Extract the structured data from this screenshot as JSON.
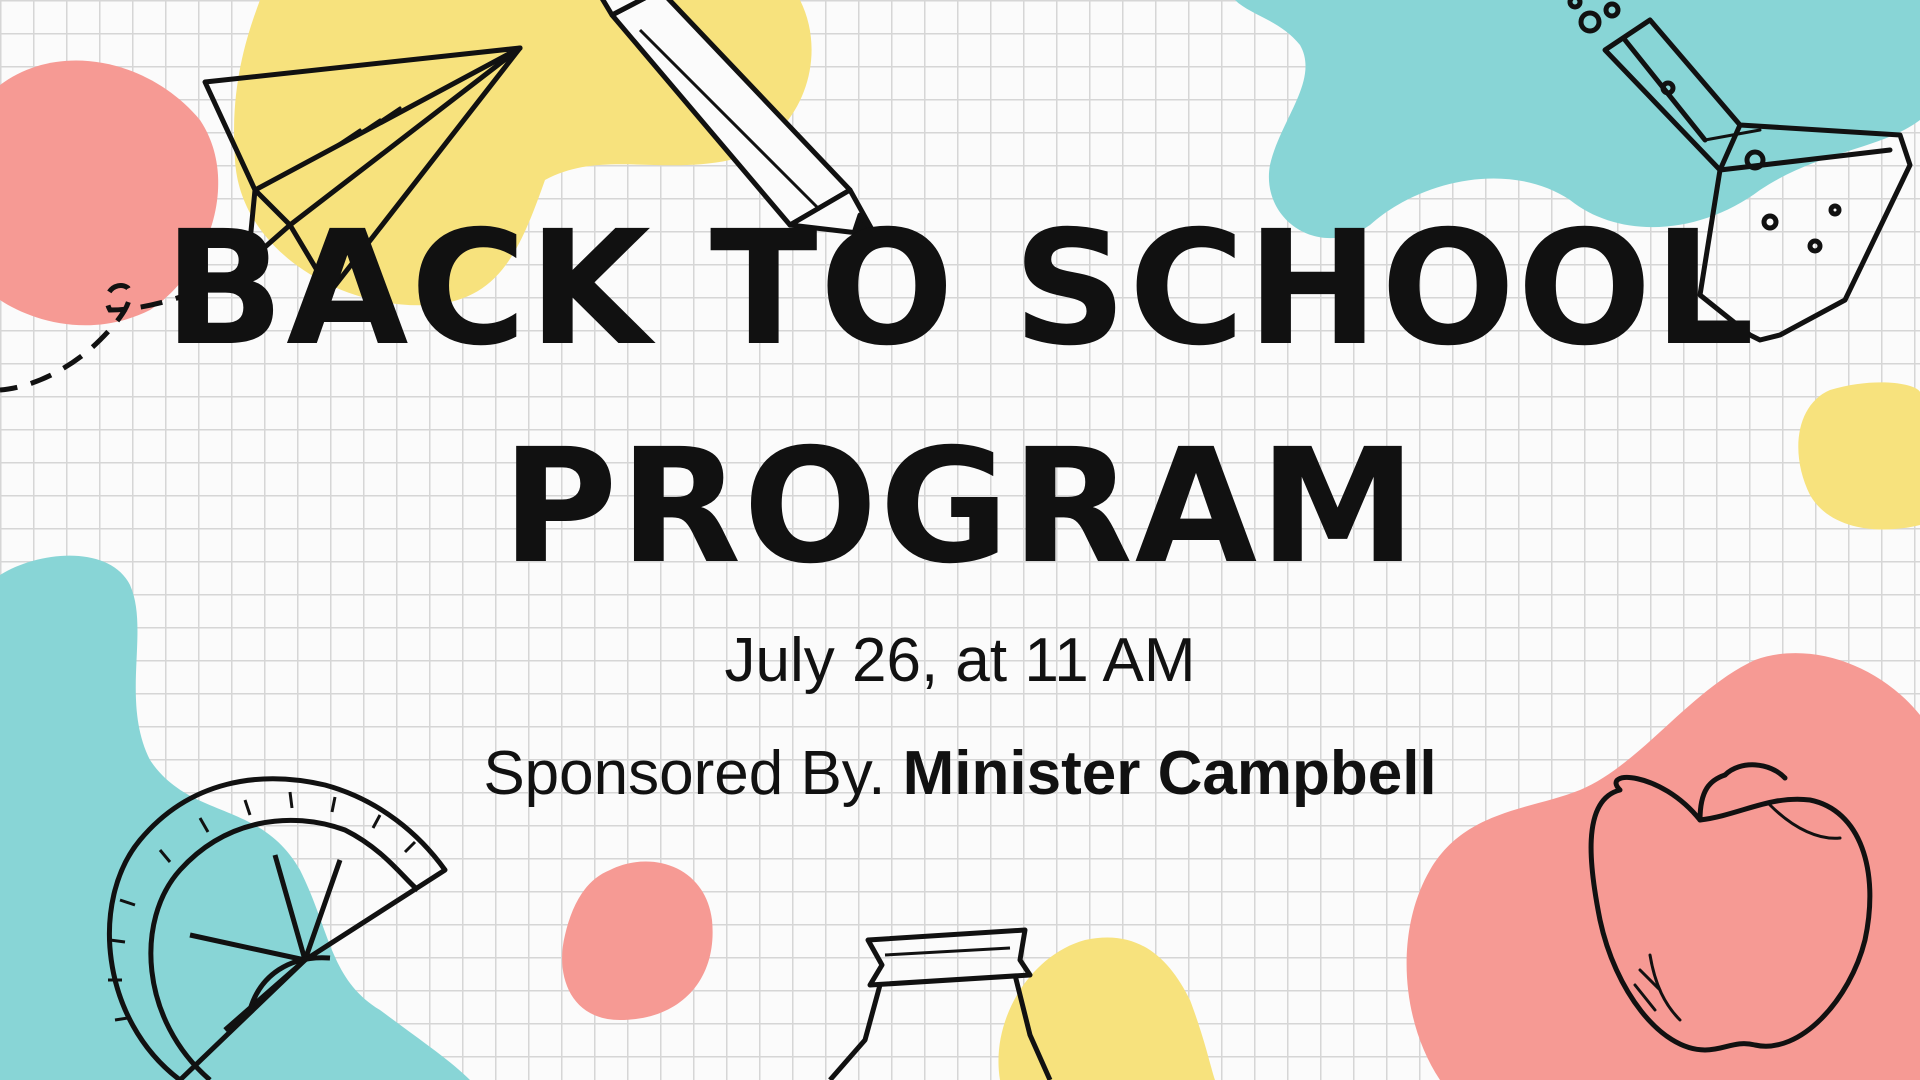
{
  "title": {
    "line1": "BACK TO SCHOOL",
    "line2": "PROGRAM"
  },
  "event_date": "July 26, at 11 AM",
  "sponsor": {
    "prefix": "Sponsored By. ",
    "name": "Minister Campbell"
  },
  "colors": {
    "pink": "#f69a94",
    "yellow": "#f7e27d",
    "teal": "#88d5d6",
    "ink": "#111111"
  },
  "doodles": [
    "paper-plane-icon",
    "pencil-icon",
    "flask-icon",
    "protractor-icon",
    "apple-icon",
    "jar-icon"
  ]
}
